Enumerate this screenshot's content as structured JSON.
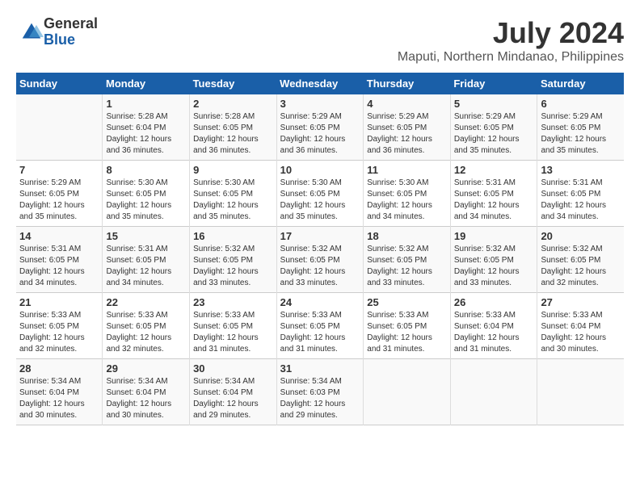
{
  "header": {
    "logo_general": "General",
    "logo_blue": "Blue",
    "title": "July 2024",
    "subtitle": "Maputi, Northern Mindanao, Philippines"
  },
  "calendar": {
    "days_of_week": [
      "Sunday",
      "Monday",
      "Tuesday",
      "Wednesday",
      "Thursday",
      "Friday",
      "Saturday"
    ],
    "weeks": [
      [
        {
          "day": "",
          "info": ""
        },
        {
          "day": "1",
          "info": "Sunrise: 5:28 AM\nSunset: 6:04 PM\nDaylight: 12 hours\nand 36 minutes."
        },
        {
          "day": "2",
          "info": "Sunrise: 5:28 AM\nSunset: 6:05 PM\nDaylight: 12 hours\nand 36 minutes."
        },
        {
          "day": "3",
          "info": "Sunrise: 5:29 AM\nSunset: 6:05 PM\nDaylight: 12 hours\nand 36 minutes."
        },
        {
          "day": "4",
          "info": "Sunrise: 5:29 AM\nSunset: 6:05 PM\nDaylight: 12 hours\nand 36 minutes."
        },
        {
          "day": "5",
          "info": "Sunrise: 5:29 AM\nSunset: 6:05 PM\nDaylight: 12 hours\nand 35 minutes."
        },
        {
          "day": "6",
          "info": "Sunrise: 5:29 AM\nSunset: 6:05 PM\nDaylight: 12 hours\nand 35 minutes."
        }
      ],
      [
        {
          "day": "7",
          "info": "Sunrise: 5:29 AM\nSunset: 6:05 PM\nDaylight: 12 hours\nand 35 minutes."
        },
        {
          "day": "8",
          "info": "Sunrise: 5:30 AM\nSunset: 6:05 PM\nDaylight: 12 hours\nand 35 minutes."
        },
        {
          "day": "9",
          "info": "Sunrise: 5:30 AM\nSunset: 6:05 PM\nDaylight: 12 hours\nand 35 minutes."
        },
        {
          "day": "10",
          "info": "Sunrise: 5:30 AM\nSunset: 6:05 PM\nDaylight: 12 hours\nand 35 minutes."
        },
        {
          "day": "11",
          "info": "Sunrise: 5:30 AM\nSunset: 6:05 PM\nDaylight: 12 hours\nand 34 minutes."
        },
        {
          "day": "12",
          "info": "Sunrise: 5:31 AM\nSunset: 6:05 PM\nDaylight: 12 hours\nand 34 minutes."
        },
        {
          "day": "13",
          "info": "Sunrise: 5:31 AM\nSunset: 6:05 PM\nDaylight: 12 hours\nand 34 minutes."
        }
      ],
      [
        {
          "day": "14",
          "info": "Sunrise: 5:31 AM\nSunset: 6:05 PM\nDaylight: 12 hours\nand 34 minutes."
        },
        {
          "day": "15",
          "info": "Sunrise: 5:31 AM\nSunset: 6:05 PM\nDaylight: 12 hours\nand 34 minutes."
        },
        {
          "day": "16",
          "info": "Sunrise: 5:32 AM\nSunset: 6:05 PM\nDaylight: 12 hours\nand 33 minutes."
        },
        {
          "day": "17",
          "info": "Sunrise: 5:32 AM\nSunset: 6:05 PM\nDaylight: 12 hours\nand 33 minutes."
        },
        {
          "day": "18",
          "info": "Sunrise: 5:32 AM\nSunset: 6:05 PM\nDaylight: 12 hours\nand 33 minutes."
        },
        {
          "day": "19",
          "info": "Sunrise: 5:32 AM\nSunset: 6:05 PM\nDaylight: 12 hours\nand 33 minutes."
        },
        {
          "day": "20",
          "info": "Sunrise: 5:32 AM\nSunset: 6:05 PM\nDaylight: 12 hours\nand 32 minutes."
        }
      ],
      [
        {
          "day": "21",
          "info": "Sunrise: 5:33 AM\nSunset: 6:05 PM\nDaylight: 12 hours\nand 32 minutes."
        },
        {
          "day": "22",
          "info": "Sunrise: 5:33 AM\nSunset: 6:05 PM\nDaylight: 12 hours\nand 32 minutes."
        },
        {
          "day": "23",
          "info": "Sunrise: 5:33 AM\nSunset: 6:05 PM\nDaylight: 12 hours\nand 31 minutes."
        },
        {
          "day": "24",
          "info": "Sunrise: 5:33 AM\nSunset: 6:05 PM\nDaylight: 12 hours\nand 31 minutes."
        },
        {
          "day": "25",
          "info": "Sunrise: 5:33 AM\nSunset: 6:05 PM\nDaylight: 12 hours\nand 31 minutes."
        },
        {
          "day": "26",
          "info": "Sunrise: 5:33 AM\nSunset: 6:04 PM\nDaylight: 12 hours\nand 31 minutes."
        },
        {
          "day": "27",
          "info": "Sunrise: 5:33 AM\nSunset: 6:04 PM\nDaylight: 12 hours\nand 30 minutes."
        }
      ],
      [
        {
          "day": "28",
          "info": "Sunrise: 5:34 AM\nSunset: 6:04 PM\nDaylight: 12 hours\nand 30 minutes."
        },
        {
          "day": "29",
          "info": "Sunrise: 5:34 AM\nSunset: 6:04 PM\nDaylight: 12 hours\nand 30 minutes."
        },
        {
          "day": "30",
          "info": "Sunrise: 5:34 AM\nSunset: 6:04 PM\nDaylight: 12 hours\nand 29 minutes."
        },
        {
          "day": "31",
          "info": "Sunrise: 5:34 AM\nSunset: 6:03 PM\nDaylight: 12 hours\nand 29 minutes."
        },
        {
          "day": "",
          "info": ""
        },
        {
          "day": "",
          "info": ""
        },
        {
          "day": "",
          "info": ""
        }
      ]
    ]
  }
}
